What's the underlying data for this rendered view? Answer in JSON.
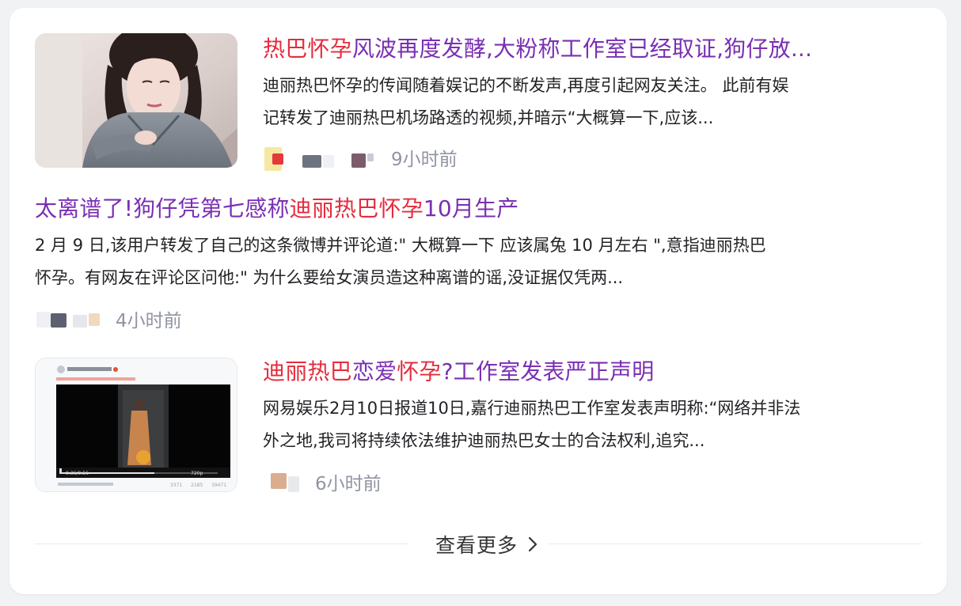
{
  "colors": {
    "title": "#7a2fb3",
    "highlight": "#e62b3c",
    "body_text": "#222326",
    "meta_text": "#9195a3"
  },
  "results": [
    {
      "title_parts": [
        "热巴怀孕",
        "风波再度发酵,大粉称工作室已经取证,狗仔放..."
      ],
      "desc_lines": [
        "迪丽热巴怀孕的传闻随着娱记的不断发声,再度引起网友关注。 此前有娱",
        "记转发了迪丽热巴机场路透的视频,并暗示“大概算一下,应该..."
      ],
      "time": "9小时前"
    },
    {
      "title_parts": [
        "太离谱了!狗仔凭第七感称",
        "迪丽热巴怀孕",
        "10月生产"
      ],
      "desc_lines": [
        "2 月 9 日,该用户转发了自己的这条微博并评论道:\" 大概算一下 应该属兔 10 月左右 \",意指迪丽热巴",
        "怀孕。有网友在评论区问他:\" 为什么要给女演员造这种离谱的谣,没证据仅凭两..."
      ],
      "time": "4小时前"
    },
    {
      "title_parts": [
        "迪丽热巴",
        "恋爱",
        "怀孕",
        "?工作室发表严正声明"
      ],
      "desc_lines": [
        "网易娱乐2月10日报道10日,嘉行迪丽热巴工作室发表声明称:“网络并非法",
        "外之地,我司将持续依法维护迪丽热巴女士的合法权利,追究..."
      ],
      "time": "6小时前",
      "video": {
        "quality": "720p",
        "time_display": "0:36/0:56",
        "stats": [
          "3371",
          "2185",
          "39471"
        ]
      }
    }
  ],
  "more": {
    "label": "查看更多"
  }
}
